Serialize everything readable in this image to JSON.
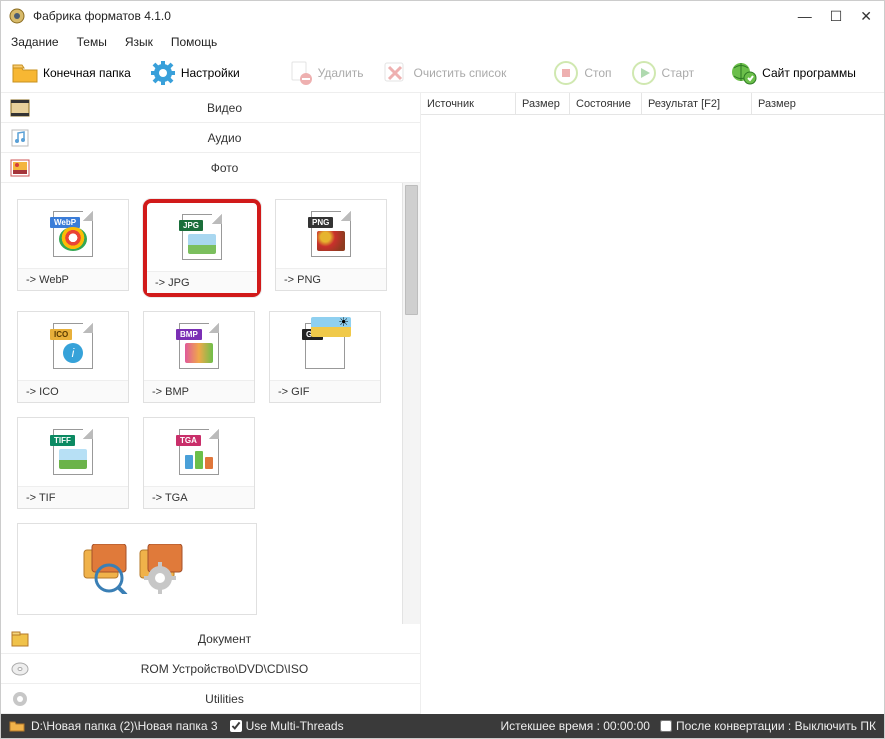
{
  "window": {
    "title": "Фабрика форматов 4.1.0"
  },
  "menu": {
    "task": "Задание",
    "themes": "Темы",
    "language": "Язык",
    "help": "Помощь"
  },
  "toolbar": {
    "outfolder": "Конечная папка",
    "settings": "Настройки",
    "delete": "Удалить",
    "clear": "Очистить список",
    "stop": "Стоп",
    "start": "Старт",
    "website": "Сайт программы"
  },
  "categories": {
    "video": "Видео",
    "audio": "Аудио",
    "photo": "Фото",
    "document": "Документ",
    "rom": "ROM Устройство\\DVD\\CD\\ISO",
    "utilities": "Utilities"
  },
  "formats": {
    "webp": "-> WebP",
    "jpg": "-> JPG",
    "png": "-> PNG",
    "ico": "-> ICO",
    "bmp": "-> BMP",
    "gif": "-> GIF",
    "tif": "-> TIF",
    "tga": "-> TGA"
  },
  "columns": {
    "source": "Источник",
    "size": "Размер",
    "state": "Состояние",
    "result": "Результат [F2]",
    "size2": "Размер"
  },
  "status": {
    "path": "D:\\Новая папка (2)\\Новая папка 3",
    "mt": "Use Multi-Threads",
    "elapsed": "Истекшее время : 00:00:00",
    "after": "После конвертации : Выключить ПК"
  }
}
